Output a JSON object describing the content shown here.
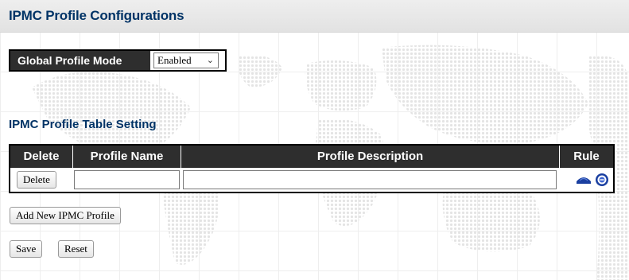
{
  "header": {
    "title": "IPMC Profile Configurations"
  },
  "global_mode": {
    "label": "Global Profile Mode",
    "selected": "Enabled"
  },
  "table_section": {
    "title": "IPMC Profile Table Setting",
    "columns": [
      "Delete",
      "Profile Name",
      "Profile Description",
      "Rule"
    ],
    "rows": [
      {
        "delete_label": "Delete",
        "profile_name": "",
        "profile_description": "",
        "rule_icons": [
          "navigate-rule-icon",
          "edit-rule-icon"
        ]
      }
    ]
  },
  "actions": {
    "add_label": "Add New IPMC Profile",
    "save_label": "Save",
    "reset_label": "Reset"
  },
  "colors": {
    "title": "#003366",
    "table_header": "#2e2e2e",
    "rule_icon_blue": "#1a3fa0"
  }
}
